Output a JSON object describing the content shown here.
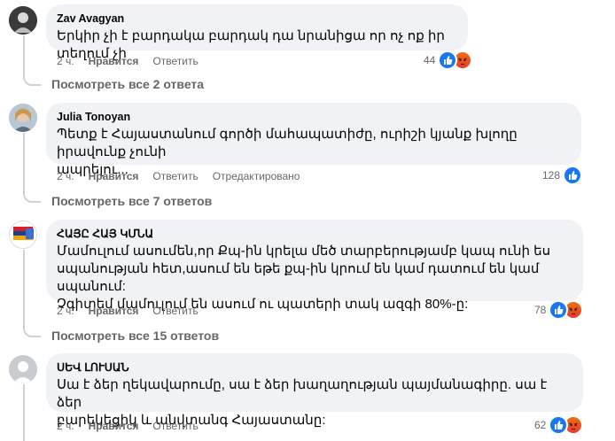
{
  "comments": [
    {
      "author": "Zav Avagyan",
      "text": "Երկիր չի է բարդակա բարդակ դա նրանիցա որ ոչ ոք իր տեղում չի",
      "time": "2 ч.",
      "like_label": "Нравится",
      "reply_label": "Ответить",
      "edited_label": "",
      "reaction_count": "44",
      "reactions": [
        "like-icon",
        "angry-icon"
      ],
      "replies_label": "Посмотреть все 2 ответа"
    },
    {
      "author": "Julia Tonoyan",
      "text": "Պետք է Հայաստանում գործի մահապատիժը, ուրիշի կյանք խլողը իրավունք չունի\nապրելու...",
      "time": "2 ч.",
      "like_label": "Нравится",
      "reply_label": "Ответить",
      "edited_label": "Отредактировано",
      "reaction_count": "128",
      "reactions": [
        "like-icon"
      ],
      "replies_label": "Посмотреть все 7 ответов"
    },
    {
      "author": "ՀԱՅԸ ՀԱՅ ԿՄՆԱ",
      "text": "Մամուլում ասումեն,որ Քպ-ին կրելա մեծ տարբերությամբ կապ ունի ես\nսպանության հետ,ասում են եթե քպ-ին կրում են կամ դատում են կամ սպանում:\nՉգիտեմ մամուլում են ասում ու պատերի տակ ազգի 80%-ը:",
      "time": "2 ч.",
      "like_label": "Нравится",
      "reply_label": "Ответить",
      "edited_label": "",
      "reaction_count": "78",
      "reactions": [
        "like-icon",
        "angry-icon"
      ],
      "replies_label": "Посмотреть все 15 ответов"
    },
    {
      "author": "ՍԵՎ ԼՈՒՍԱՆ",
      "text": "Սա է ձեր ղեկավարումը, սա է ձեր խաղաղության պայմանագիրը. սա է ձեր\nբարեկեցիկ և անվտանգ Հայաստանը:",
      "time": "2 ч.",
      "like_label": "Нравится",
      "reply_label": "Ответить",
      "edited_label": "",
      "reaction_count": "62",
      "reactions": [
        "like-icon",
        "angry-icon"
      ],
      "replies_label": ""
    }
  ],
  "colors": {
    "bubble": "#f0f2f5",
    "meta": "#65676b",
    "like": "#1877f2",
    "angry": "#f0372a"
  }
}
